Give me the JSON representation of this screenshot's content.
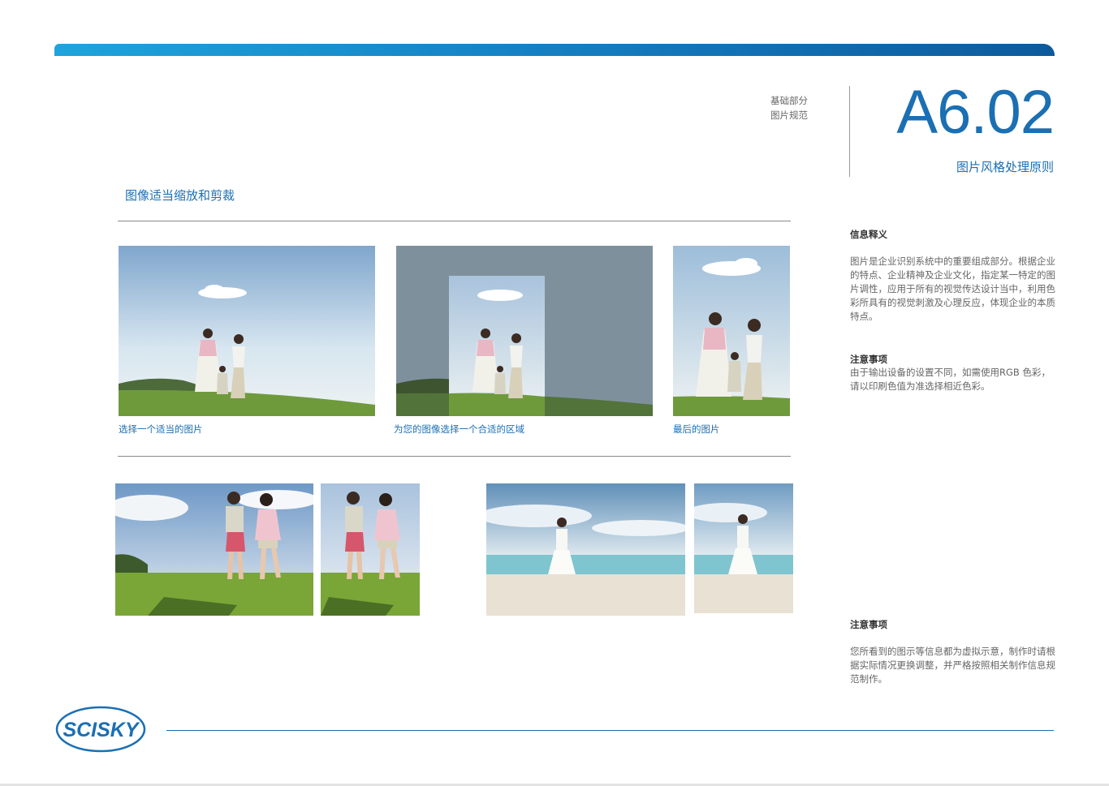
{
  "header": {
    "section_line1": "基础部分",
    "section_line2": "图片规范",
    "page_code": "A6.02",
    "page_title": "图片风格处理原则"
  },
  "main": {
    "subheading": "图像适当缩放和剪裁",
    "captions": [
      "选择一个适当的图片",
      "为您的图像选择一个合适的区域",
      "最后的图片"
    ]
  },
  "sidebar": {
    "info_heading": "信息释义",
    "info_text": "图片是企业识别系统中的重要组成部分。根据企业的特点、企业精神及企业文化，指定某一特定的图片调性，应用于所有的视觉传达设计当中，利用色彩所具有的视觉刺激及心理反应，体现企业的本质特点。",
    "note_heading": "注意事项",
    "note_text": "由于输出设备的设置不同，如需使用RGB 色彩，请以印刷色值为准选择相近色彩。",
    "note2_heading": "注意事项",
    "note2_text": "您所看到的图示等信息都为虚拟示意，制作时请根据实际情况更换调整，并严格按照相关制作信息规范制作。"
  },
  "footer": {
    "logo_text": "SCISKY"
  },
  "colors": {
    "brand_blue": "#1b6fb3",
    "bar_light": "#1ea4dc",
    "bar_dark": "#0c5a9c"
  }
}
